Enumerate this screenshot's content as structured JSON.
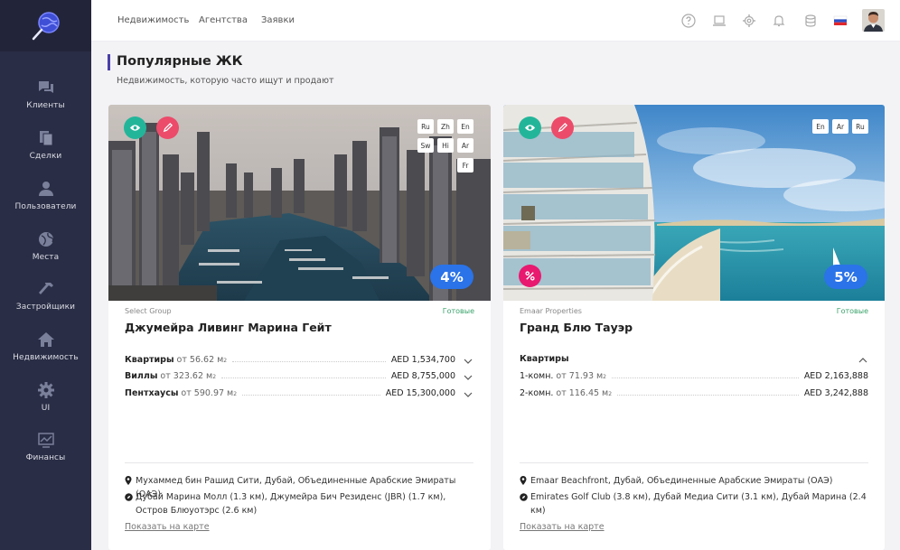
{
  "sidebar": {
    "items": [
      {
        "label": "Клиенты",
        "icon": "chat-icon"
      },
      {
        "label": "Сделки",
        "icon": "documents-icon"
      },
      {
        "label": "Пользователи",
        "icon": "users-icon"
      },
      {
        "label": "Места",
        "icon": "globe-icon"
      },
      {
        "label": "Застройщики",
        "icon": "hammer-icon"
      },
      {
        "label": "Недвижимость",
        "icon": "home-icon"
      },
      {
        "label": "UI",
        "icon": "gear-icon"
      },
      {
        "label": "Финансы",
        "icon": "chart-icon"
      }
    ]
  },
  "topnav": [
    "Недвижимость",
    "Агентства",
    "Заявки"
  ],
  "header": {
    "title": "Популярные ЖК",
    "subtitle": "Недвижимость, которую часто ищут и продают"
  },
  "cards": [
    {
      "developer": "Select Group",
      "status": "Готовые",
      "name": "Джумейра Ливинг Марина Гейт",
      "langs": [
        "Ru",
        "Zh",
        "En",
        "Sw",
        "Hi",
        "Ar",
        "Fr"
      ],
      "discount": "4%",
      "rows": [
        {
          "label": "Квартиры",
          "from": "от 56.62 м",
          "sup": "2",
          "price": "AED 1,534,700"
        },
        {
          "label": "Виллы",
          "from": "от 323.62 м",
          "sup": "2",
          "price": "AED 8,755,000"
        },
        {
          "label": "Пентхаусы",
          "from": "от 590.97 м",
          "sup": "2",
          "price": "AED 15,300,000"
        }
      ],
      "address": "Мухаммед бин Рашид Сити, Дубай, Объединенные Арабские Эмираты (ОАЭ)",
      "nearby": "Дубай Марина Молл (1.3 км), Джумейра Бич Резиденс (JBR) (1.7 км), Остров Блюуотэрс (2.6 км)",
      "map_link": "Показать на карте"
    },
    {
      "developer": "Emaar Properties",
      "status": "Готовые",
      "name": "Гранд Блю Тауэр",
      "langs": [
        "En",
        "Ar",
        "Ru"
      ],
      "discount": "5%",
      "group_label": "Квартиры",
      "rows": [
        {
          "label": "1-комн.",
          "from": "от 71.93 м",
          "sup": "2",
          "price": "AED 2,163,888"
        },
        {
          "label": "2-комн.",
          "from": "от 116.45 м",
          "sup": "2",
          "price": "AED 3,242,888"
        }
      ],
      "address": "Emaar Beachfront, Дубай, Объединенные Арабские Эмираты (ОАЭ)",
      "nearby": "Emirates Golf Club (3.8 км), Дубай Медиа Сити (3.1 км), Дубай Марина (2.4 км)",
      "map_link": "Показать на карте"
    }
  ],
  "colors": {
    "sidebar": "#292d45",
    "accent": "#4a3fa8",
    "eye_button": "#23b59a",
    "edit_button": "#ec4b6a",
    "discount_badge": "#2a73e8",
    "percent_badge": "#e8196f",
    "status": "#3aa36b"
  }
}
